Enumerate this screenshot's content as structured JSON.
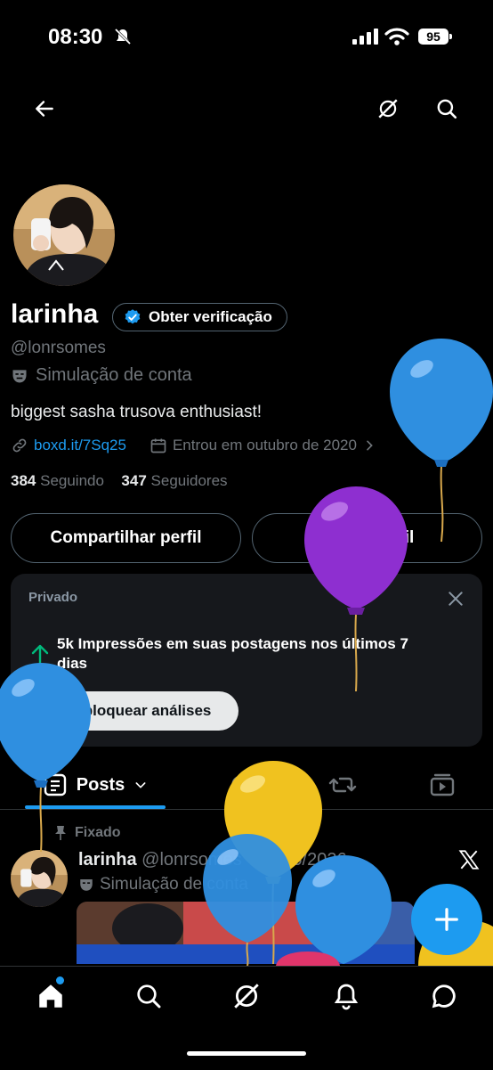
{
  "status_bar": {
    "time": "08:30",
    "battery": "95"
  },
  "profile": {
    "name": "larinha",
    "verify_label": "Obter verificação",
    "handle": "@lonrsomes",
    "simulation_label": "Simulação de conta",
    "bio": "biggest sasha trusova enthusiast!",
    "link": "boxd.it/7Sq25",
    "joined": "Entrou em outubro de 2020",
    "following_count": "384",
    "following_label": "Seguindo",
    "followers_count": "347",
    "followers_label": "Seguidores"
  },
  "buttons": {
    "share": "Compartilhar perfil",
    "edit": "Editar perfil"
  },
  "analytics_card": {
    "private_label": "Privado",
    "message": "5k Impressões em suas postagens nos últimos 7 dias",
    "unlock": "Desbloquear análises"
  },
  "tabs": {
    "posts": "Posts"
  },
  "post": {
    "pinned_label": "Fixado",
    "author": "larinha",
    "handle_date": "@lonrsomes · 01/05/2026",
    "simulation_label": "Simulação de conta"
  },
  "colors": {
    "accent": "#1d9bf0",
    "background": "#000000",
    "muted": "#71767b"
  }
}
